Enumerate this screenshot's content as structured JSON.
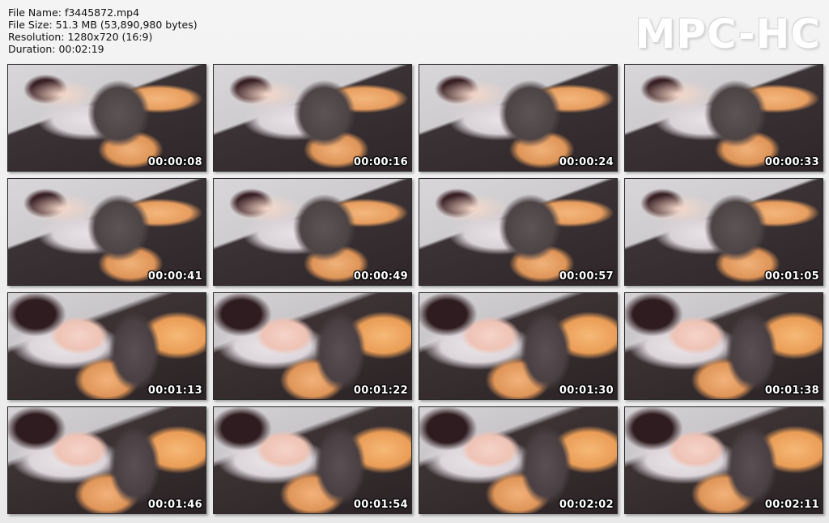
{
  "file_info": {
    "file_name": "File Name: f3445872.mp4",
    "file_size": "File Size: 51.3 MB (53,890,980 bytes)",
    "resolution": "Resolution: 1280x720 (16:9)",
    "duration": "Duration: 00:02:19"
  },
  "logo": "MPC-HC",
  "thumbnails": [
    {
      "timestamp": "00:00:08"
    },
    {
      "timestamp": "00:00:16"
    },
    {
      "timestamp": "00:00:24"
    },
    {
      "timestamp": "00:00:33"
    },
    {
      "timestamp": "00:00:41"
    },
    {
      "timestamp": "00:00:49"
    },
    {
      "timestamp": "00:00:57"
    },
    {
      "timestamp": "00:01:05"
    },
    {
      "timestamp": "00:01:13"
    },
    {
      "timestamp": "00:01:22"
    },
    {
      "timestamp": "00:01:30"
    },
    {
      "timestamp": "00:01:38"
    },
    {
      "timestamp": "00:01:46"
    },
    {
      "timestamp": "00:01:54"
    },
    {
      "timestamp": "00:02:02"
    },
    {
      "timestamp": "00:02:11"
    }
  ]
}
